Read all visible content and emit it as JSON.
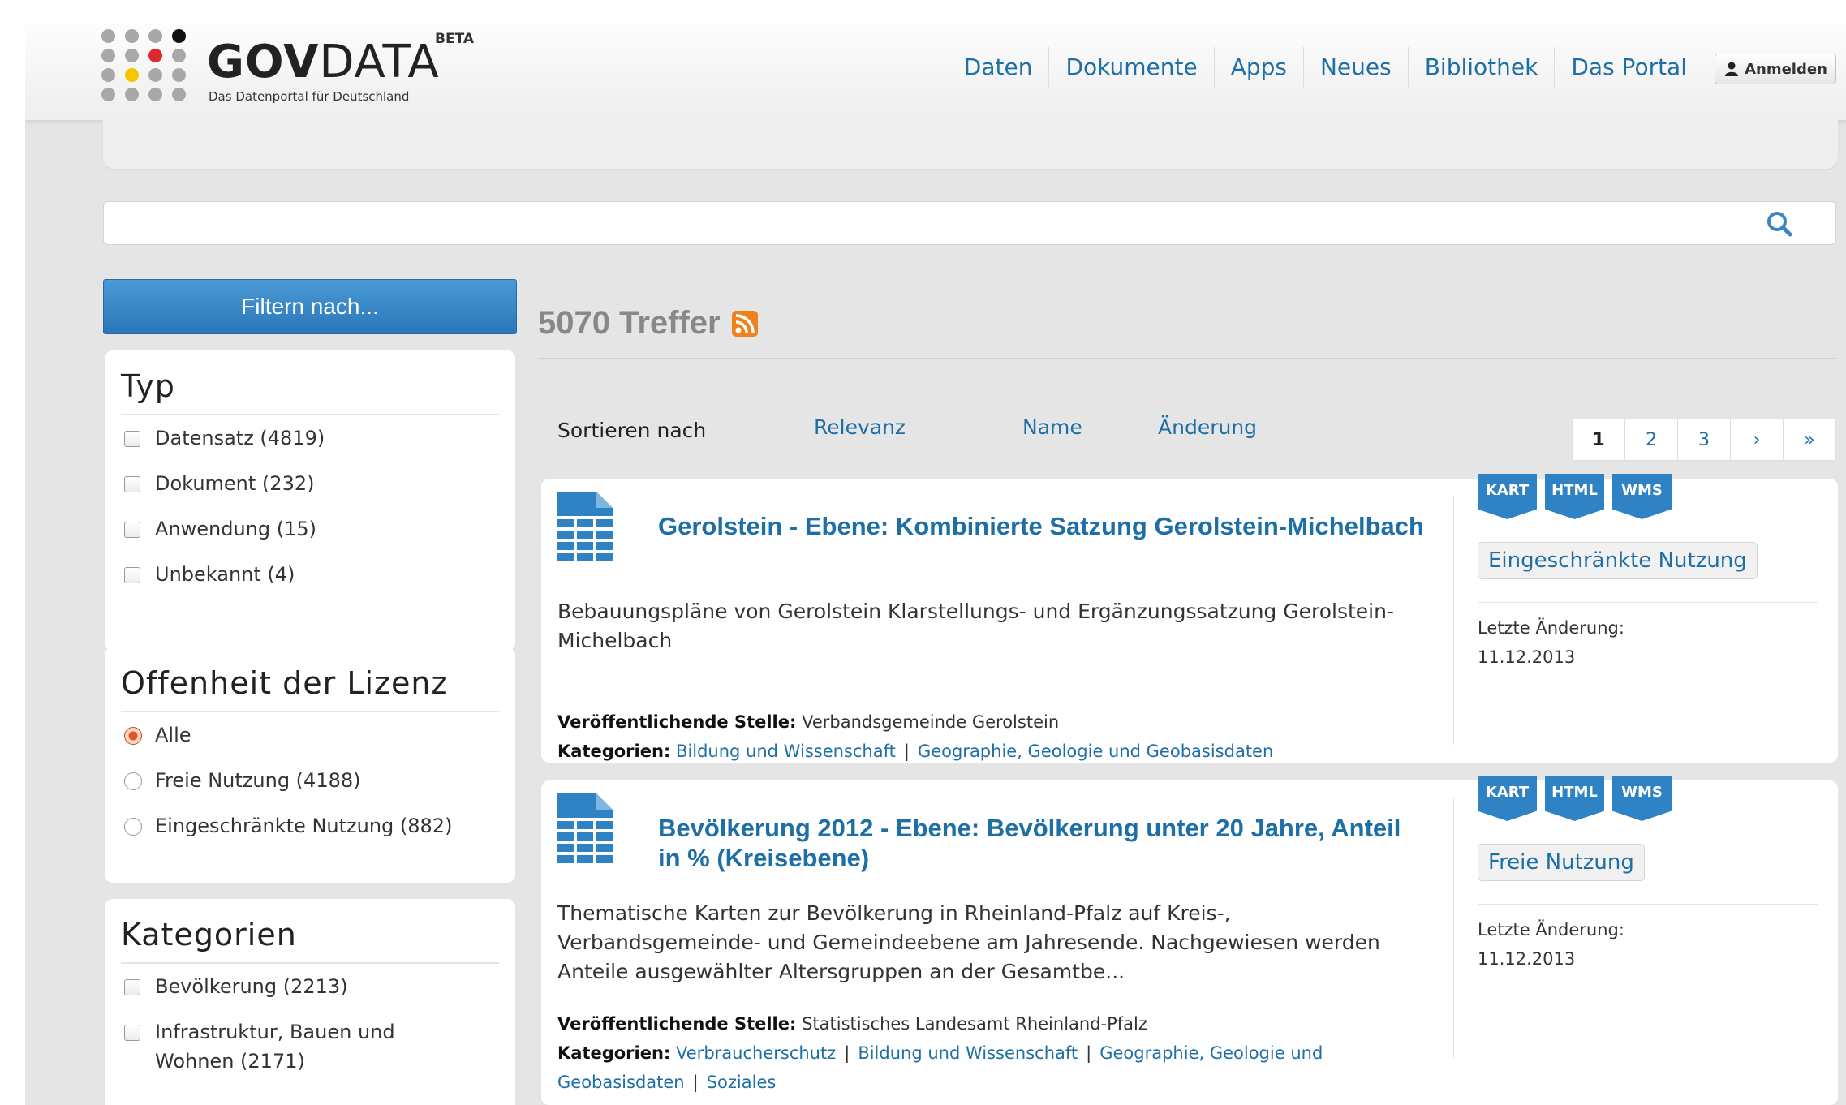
{
  "header": {
    "logo_brand_bold": "GOV",
    "logo_brand_rest": "DATA",
    "logo_badge": "BETA",
    "logo_tagline": "Das Datenportal für Deutschland",
    "nav": [
      {
        "label": "Daten"
      },
      {
        "label": "Dokumente"
      },
      {
        "label": "Apps"
      },
      {
        "label": "Neues"
      },
      {
        "label": "Bibliothek"
      },
      {
        "label": "Das Portal"
      }
    ],
    "login_label": "Anmelden"
  },
  "search": {
    "value": "",
    "icon": "search-icon"
  },
  "sidebar": {
    "filter_button": "Filtern nach...",
    "facets": [
      {
        "title": "Typ",
        "control": "checkbox",
        "items": [
          {
            "label": "Datensatz (4819)",
            "checked": false
          },
          {
            "label": "Dokument (232)",
            "checked": false
          },
          {
            "label": "Anwendung (15)",
            "checked": false
          },
          {
            "label": "Unbekannt (4)",
            "checked": false
          }
        ]
      },
      {
        "title": "Offenheit der Lizenz",
        "control": "radio",
        "items": [
          {
            "label": "Alle",
            "checked": true
          },
          {
            "label": "Freie Nutzung (4188)",
            "checked": false
          },
          {
            "label": "Eingeschränkte Nutzung (882)",
            "checked": false
          }
        ]
      },
      {
        "title": "Kategorien",
        "control": "checkbox",
        "items": [
          {
            "label": "Bevölkerung (2213)",
            "checked": false
          },
          {
            "label": "Infrastruktur, Bauen und Wohnen (2171)",
            "checked": false
          }
        ]
      }
    ]
  },
  "results": {
    "count_label": "5070 Treffer",
    "sort": {
      "label": "Sortieren nach",
      "options": [
        "Relevanz",
        "Name",
        "Änderung"
      ]
    },
    "pager": [
      "1",
      "2",
      "3",
      "›",
      "»"
    ],
    "pager_active": "1",
    "items": [
      {
        "title": "Gerolstein - Ebene: Kombinierte Satzung Gerolstein-Michelbach",
        "description": "Bebauungspläne von Gerolstein Klarstellungs- und Ergänzungssatzung Gerolstein-Michelbach",
        "publisher_label": "Veröffentlichende Stelle:",
        "publisher": "Verbandsgemeinde Gerolstein",
        "categories_label": "Kategorien:",
        "categories": [
          "Bildung und Wissenschaft",
          "Geographie, Geologie und Geobasisdaten"
        ],
        "formats": [
          "KART",
          "HTML",
          "WMS"
        ],
        "license": "Eingeschränkte Nutzung",
        "modified_label": "Letzte Änderung:",
        "modified": "11.12.2013"
      },
      {
        "title": "Bevölkerung 2012 - Ebene: Bevölkerung unter 20 Jahre, Anteil in % (Kreisebene)",
        "description": "Thematische Karten zur Bevölkerung in Rheinland-Pfalz auf Kreis-, Verbandsgemeinde- und Gemeindeebene am Jahresende. Nachgewiesen werden Anteile ausgewählter Altersgruppen an der Gesamtbe...",
        "publisher_label": "Veröffentlichende Stelle:",
        "publisher": "Statistisches Landesamt Rheinland-Pfalz",
        "categories_label": "Kategorien:",
        "categories": [
          "Verbraucherschutz",
          "Bildung und Wissenschaft",
          "Geographie, Geologie und Geobasisdaten",
          "Soziales"
        ],
        "formats": [
          "KART",
          "HTML",
          "WMS"
        ],
        "license": "Freie Nutzung",
        "modified_label": "Letzte Änderung:",
        "modified": "11.12.2013"
      }
    ]
  },
  "colors": {
    "link": "#1e6fa5",
    "tag": "#2f82c3",
    "filter_button": "#2a77b8",
    "logo_red": "#e0262e",
    "logo_yellow": "#f6c500",
    "logo_black": "#111111",
    "rss": "#f0821e"
  }
}
